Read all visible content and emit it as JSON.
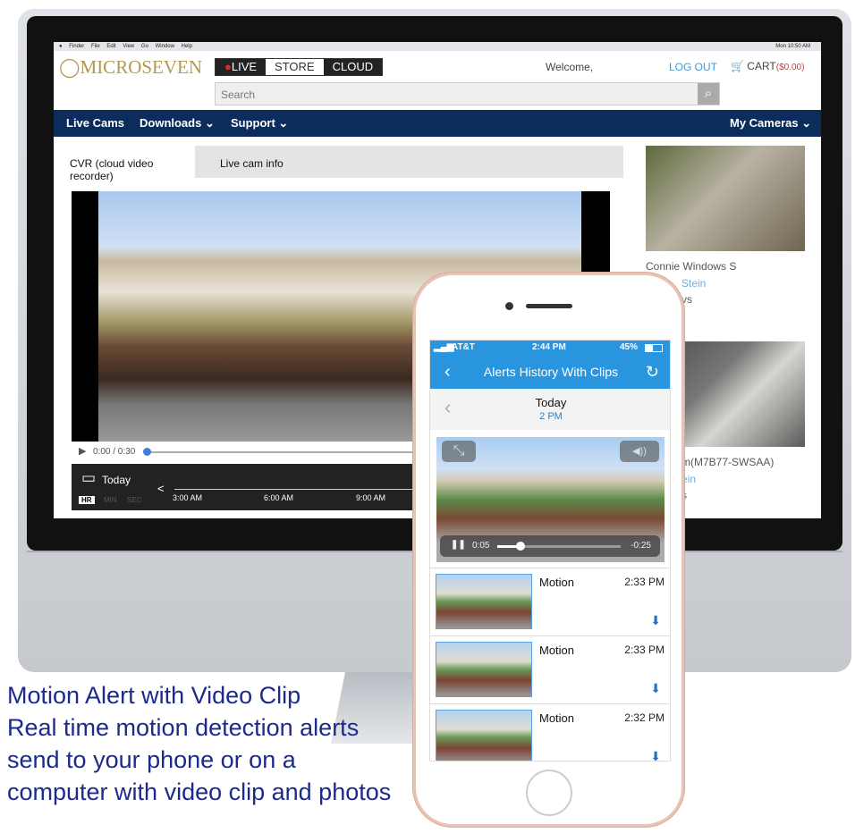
{
  "menubar": {
    "items": [
      "Finder",
      "File",
      "Edit",
      "View",
      "Go",
      "Window",
      "Help"
    ],
    "clock": "Mon 10:50 AM"
  },
  "site": {
    "logo": "MICROSEVEN",
    "topnav": [
      "LIVE",
      "STORE",
      "CLOUD"
    ],
    "welcome": "Welcome,",
    "logout": "LOG OUT",
    "cart": "CART",
    "cart_amount": "($0.00)",
    "search_placeholder": "Search",
    "nav": [
      "Live Cams",
      "Downloads ⌄",
      "Support ⌄",
      "My Cameras ⌄"
    ],
    "tabs": [
      "CVR (cloud video recorder)",
      "Live cam info"
    ],
    "player": {
      "time": "0:00 / 0:30"
    },
    "timeline": {
      "day": "Today",
      "units": [
        "HR",
        "MIN",
        "SEC"
      ],
      "ticks": [
        "3:00 AM",
        "6:00 AM",
        "9:00 AM"
      ]
    },
    "cameras": [
      {
        "name": "Connie Windows S",
        "owner": "Stein",
        "extra": "vs"
      },
      {
        "name": "m(M7B77-SWSAA)",
        "owner": "ein",
        "extra": "s"
      }
    ],
    "accent": "#0c2d5b"
  },
  "phone": {
    "status": {
      "carrier": "AT&T",
      "time": "2:44 PM",
      "battery": "45%"
    },
    "title": "Alerts History With Clips",
    "date": "Today",
    "hour": "2 PM",
    "video": {
      "elapsed": "0:05",
      "remaining": "-0:25",
      "progress": 0.17
    },
    "alerts": [
      {
        "type": "Motion",
        "time": "2:33 PM"
      },
      {
        "type": "Motion",
        "time": "2:33 PM"
      },
      {
        "type": "Motion",
        "time": "2:32 PM"
      }
    ],
    "accent": "#2a95df"
  },
  "caption": [
    "Motion Alert with Video Clip",
    "Real time motion detection alerts",
    "send to your phone or on a",
    "computer with video clip and photos"
  ]
}
